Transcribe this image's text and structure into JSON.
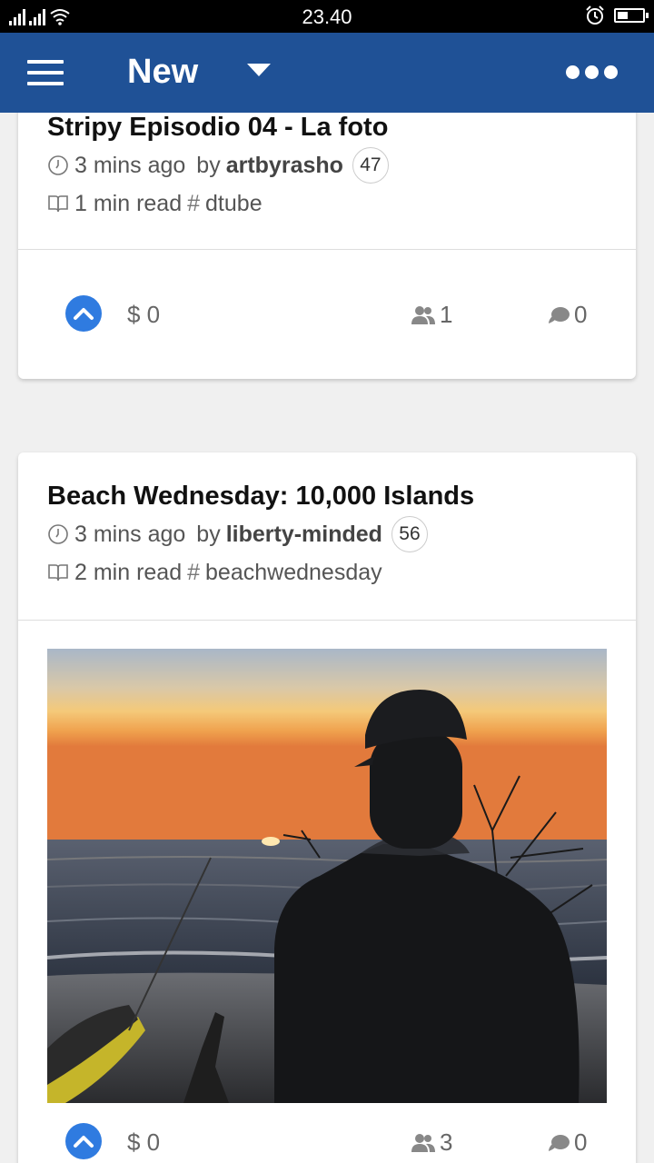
{
  "status_bar": {
    "time": "23.40"
  },
  "app_bar": {
    "title": "New",
    "menu_icon": "hamburger-icon",
    "dropdown_icon": "caret-down-icon",
    "more_icon": "more-dots-icon",
    "background": "#1f5196"
  },
  "posts": [
    {
      "title": "Stripy Episodio 04 - La foto",
      "time_ago": "3 mins ago",
      "by_label": "by",
      "author": "artbyrasho",
      "reputation": "47",
      "read_time": "1 min read",
      "hash_symbol": "#",
      "tag": "dtube",
      "payout": "$ 0",
      "voters": "1",
      "comments": "0"
    },
    {
      "title": "Beach Wednesday: 10,000 Islands",
      "time_ago": "3 mins ago",
      "by_label": "by",
      "author": "liberty-minded",
      "reputation": "56",
      "read_time": "2 min read",
      "hash_symbol": "#",
      "tag": "beachwednesday",
      "payout": "$ 0",
      "voters": "3",
      "comments": "0"
    }
  ],
  "colors": {
    "upvote": "#2f7be0"
  }
}
